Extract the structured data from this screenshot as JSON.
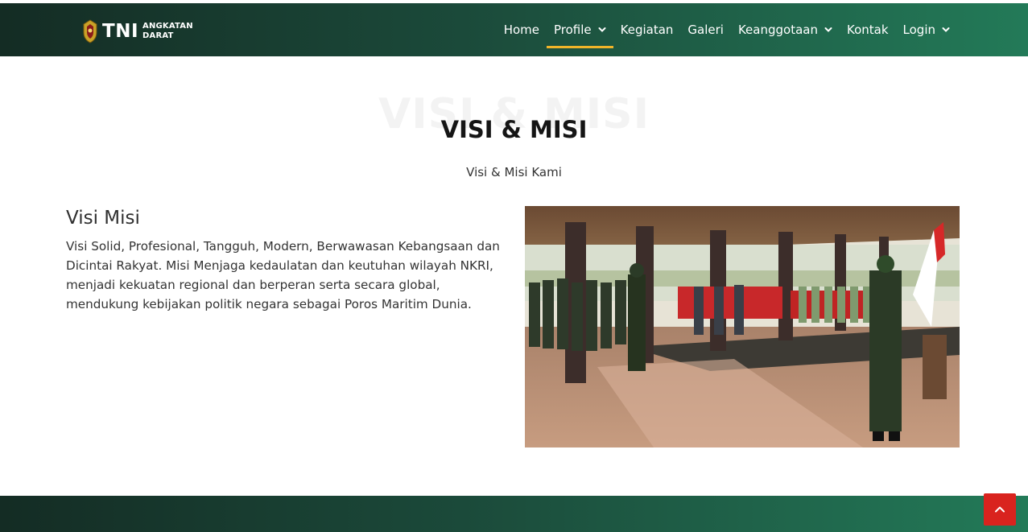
{
  "brand": {
    "short": "TNI",
    "line1": "ANGKATAN",
    "line2": "DARAT"
  },
  "nav": {
    "items": [
      {
        "label": "Home",
        "dropdown": false,
        "active": false
      },
      {
        "label": "Profile",
        "dropdown": true,
        "active": true
      },
      {
        "label": "Kegiatan",
        "dropdown": false,
        "active": false
      },
      {
        "label": "Galeri",
        "dropdown": false,
        "active": false
      },
      {
        "label": "Keanggotaan",
        "dropdown": true,
        "active": false
      },
      {
        "label": "Kontak",
        "dropdown": false,
        "active": false
      },
      {
        "label": "Login",
        "dropdown": true,
        "active": false
      }
    ]
  },
  "hero": {
    "background_text": "VISI & MISI",
    "title": "VISI & MISI",
    "subtitle": "Visi & Misi Kami"
  },
  "content": {
    "heading": "Visi Misi",
    "text": "Visi Solid, Profesional, Tangguh, Modern, Berwawasan Kebangsaan dan Dicintai Rakyat. Misi Menjaga kedaulatan dan keutuhan wilayah NKRI, menjadi kekuatan regional dan berperan serta secara global, mendukung kebijakan politik negara sebagai Poros Maritim Dunia."
  },
  "icons": {
    "chevron": "chevron-down-icon",
    "back_to_top": "arrow-up-icon",
    "emblem": "army-emblem-icon"
  },
  "colors": {
    "nav_gradient_start": "#142c24",
    "nav_gradient_end": "#237a58",
    "active_underline": "#f0b429",
    "back_to_top": "#d9231e"
  }
}
